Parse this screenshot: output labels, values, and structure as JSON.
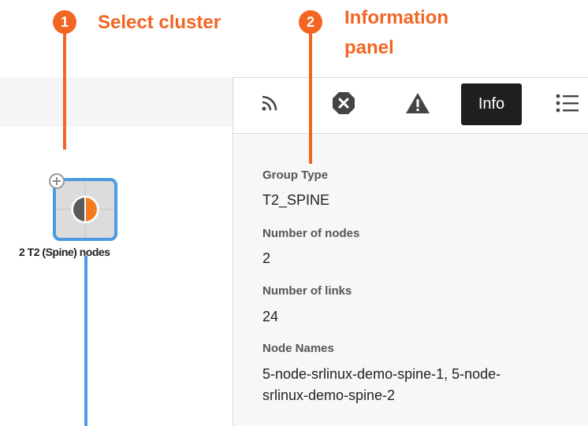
{
  "callouts": [
    {
      "number": "1",
      "label": "Select cluster"
    },
    {
      "number": "2",
      "label_line1": "Information",
      "label_line2": "panel"
    }
  ],
  "cluster": {
    "label": "2 T2 (Spine) nodes"
  },
  "toolbar": {
    "icons": [
      "rss-icon",
      "close-error-icon",
      "warning-icon",
      "list-icon"
    ],
    "active_tab": "Info"
  },
  "info": {
    "fields": [
      {
        "label": "Group Type",
        "value": "T2_SPINE"
      },
      {
        "label": "Number of nodes",
        "value": "2"
      },
      {
        "label": "Number of links",
        "value": "24"
      },
      {
        "label": "Node Names",
        "value_line1": "5-node-srlinux-demo-spine-1, 5-node-",
        "value_line2": "srlinux-demo-spine-2"
      }
    ]
  },
  "colors": {
    "callout": "#f26522",
    "selection": "#4d9be0",
    "active_tab": "#1f1f1f"
  }
}
